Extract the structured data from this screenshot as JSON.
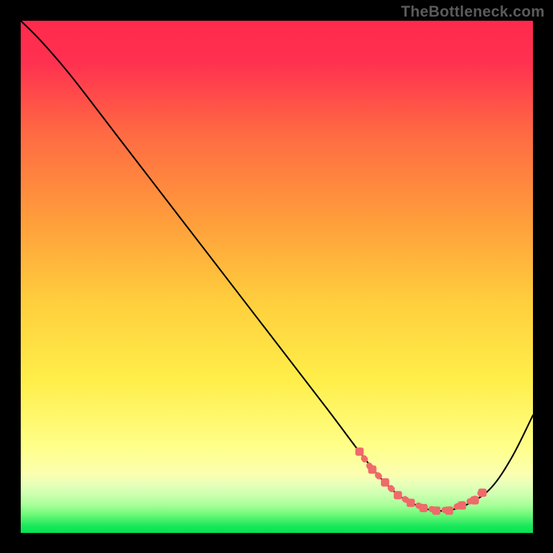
{
  "watermark": "TheBottleneck.com",
  "chart_data": {
    "type": "line",
    "title": "",
    "xlabel": "",
    "ylabel": "",
    "xlim": [
      0,
      100
    ],
    "ylim": [
      0,
      100
    ],
    "grid": false,
    "legend": false,
    "gradient": {
      "top": "#ff2a4c",
      "mid_upper": "#ff9a3b",
      "mid": "#ffd93d",
      "mid_lower": "#ffff66",
      "band": "#ddffbb",
      "bottom": "#00e550"
    },
    "series": [
      {
        "name": "curve",
        "color": "#000000",
        "x": [
          0,
          4,
          10,
          20,
          30,
          40,
          50,
          60,
          66,
          70,
          73,
          76,
          80,
          84,
          88,
          92,
          96,
          100
        ],
        "y": [
          100,
          96,
          89,
          76,
          63,
          50,
          37,
          24,
          16,
          11,
          8,
          6,
          4.5,
          4.5,
          6,
          9,
          15,
          23
        ]
      },
      {
        "name": "highlight",
        "type": "dotted",
        "color": "#ef6a6a",
        "x": [
          66,
          68.5,
          71,
          73.5,
          76,
          78.5,
          81,
          83.5,
          86,
          88.5,
          90
        ],
        "y": [
          16,
          12.5,
          10,
          7.5,
          6,
          5,
          4.5,
          4.5,
          5.5,
          6.5,
          8
        ]
      }
    ]
  }
}
